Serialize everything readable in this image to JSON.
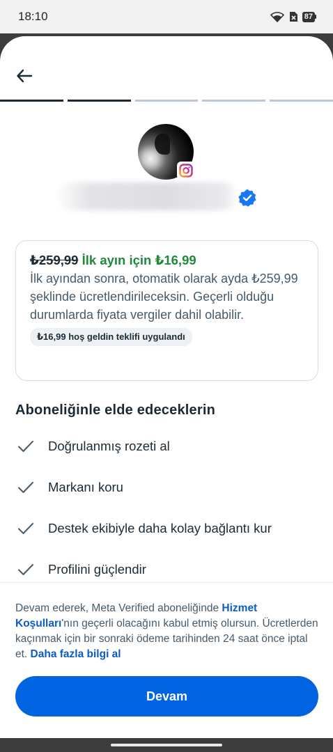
{
  "status_bar": {
    "time": "18:10",
    "battery": "87"
  },
  "progress": {
    "total_steps": 5,
    "completed_steps": 2
  },
  "offer": {
    "old_price": "₺259,99",
    "intro_price": "İlk ayın için ₺16,99",
    "description": "İlk ayından sonra, otomatik olarak ayda ₺259,99 şeklinde ücretlendirileceksin. Geçerli olduğu durumlarda fiyata vergiler dahil olabilir.",
    "tag": "₺16,99 hoş geldin teklifi uygulandı"
  },
  "benefits": {
    "title": "Aboneliğinle elde edeceklerin",
    "items": [
      {
        "label": "Doğrulanmış rozeti al"
      },
      {
        "label": "Markanı koru"
      },
      {
        "label": "Destek ekibiyle daha kolay bağlantı kur"
      },
      {
        "label": "Profilini güçlendir"
      }
    ]
  },
  "footer": {
    "terms_prefix": "Devam ederek, Meta Verified aboneliğinde ",
    "terms_link": "Hizmet Koşulları",
    "terms_middle": "'nın geçerli olacağını kabul etmiş olursun. Ücretlerden kaçınmak için bir sonraki ödeme tarihinden 24 saat önce iptal et. ",
    "learn_more_link": "Daha fazla bilgi al",
    "continue_label": "Devam"
  },
  "colors": {
    "accent": "#0064e0",
    "price_green": "#1f8a3b",
    "link_blue": "#0a5dc2",
    "verified_blue": "#1877f2"
  },
  "icons": [
    "wifi-icon",
    "no-sim-icon",
    "battery-icon",
    "back-arrow-icon",
    "instagram-icon",
    "verified-badge-icon",
    "check-icon"
  ]
}
